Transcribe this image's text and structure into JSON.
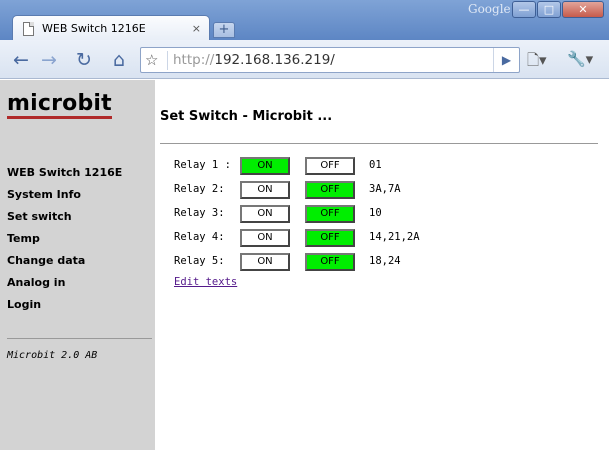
{
  "browser": {
    "tab_title": "WEB Switch 1216E",
    "tab_close": "×",
    "new_tab": "+",
    "brand": "Google",
    "url_scheme": "http://",
    "url_host": "192.168.136.219/"
  },
  "sidebar": {
    "logo": "microbit",
    "nav": [
      "WEB Switch 1216E",
      "System Info",
      "Set switch",
      "Temp",
      "Change data",
      "Analog in",
      "Login"
    ],
    "version": "Microbit 2.0 AB"
  },
  "main": {
    "title": "Set Switch - Microbit ...",
    "on_label": "ON",
    "off_label": "OFF",
    "relays": [
      {
        "label": "Relay 1 :",
        "state": "ON",
        "desc": "01"
      },
      {
        "label": "Relay 2:",
        "state": "OFF",
        "desc": "3A,7A"
      },
      {
        "label": "Relay 3:",
        "state": "OFF",
        "desc": "10"
      },
      {
        "label": "Relay 4:",
        "state": "OFF",
        "desc": "14,21,2A"
      },
      {
        "label": "Relay 5:",
        "state": "OFF",
        "desc": "18,24"
      }
    ],
    "edit_link": "Edit texts"
  },
  "colors": {
    "active_button": "#00ee00",
    "sidebar_bg": "#d3d3d3",
    "logo_underline": "#b02a2a"
  },
  "icons": {
    "back": "back-arrow-icon",
    "forward": "forward-arrow-icon",
    "reload": "reload-icon",
    "home": "home-icon",
    "bookmark": "star-icon",
    "go": "play-icon",
    "page_menu": "page-icon",
    "tools_menu": "wrench-icon"
  }
}
